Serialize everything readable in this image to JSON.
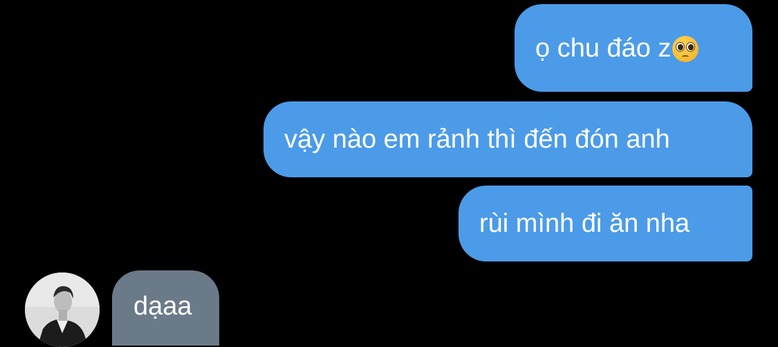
{
  "conversation": {
    "outgoing": [
      {
        "text": "ọ chu đáo z",
        "emoji": "pleading-face-emoji"
      },
      {
        "text": "vậy nào em rảnh thì đến đón anh"
      },
      {
        "text": "rùi mình đi ăn nha"
      }
    ],
    "incoming": [
      {
        "text": "dạaa"
      }
    ]
  },
  "colors": {
    "background": "#000000",
    "outgoing_bubble": "#4c9be8",
    "incoming_bubble": "#6b7a89",
    "text": "#ffffff"
  }
}
